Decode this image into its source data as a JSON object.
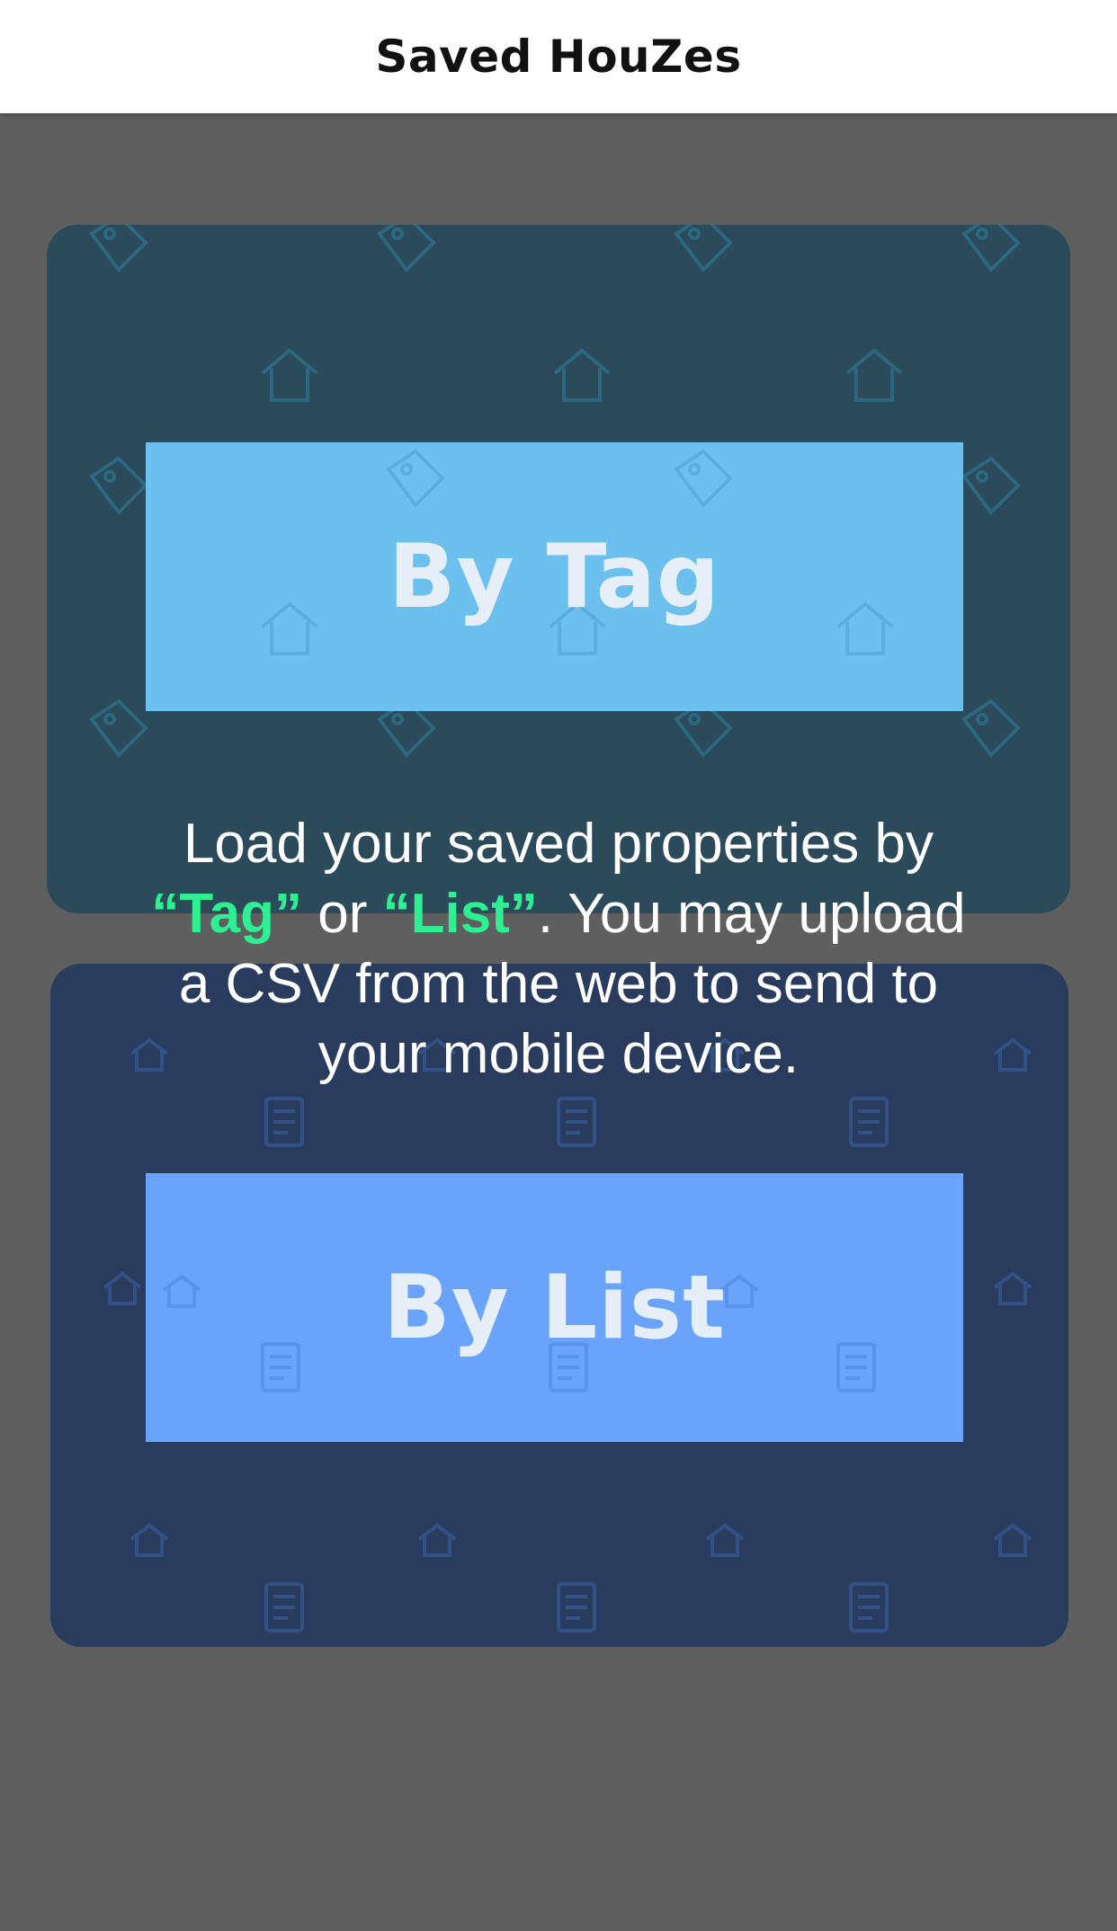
{
  "header": {
    "title": "Saved HouZes"
  },
  "buttons": {
    "by_tag": "By Tag",
    "by_list": "By List"
  },
  "message": {
    "line1": "Load your saved properties by",
    "tag_quote": "“Tag”",
    "or": " or ",
    "list_quote": "“List”",
    "after_list": ". You may upload",
    "line3": "a CSV from the web to send to",
    "line4": "your mobile device."
  },
  "colors": {
    "highlight": "#2ef093",
    "tag_button": "#6bc0ee",
    "list_button": "#6aa3fb",
    "overlay_bg": "#5f5f5f"
  },
  "icons": {
    "tag_card": [
      "house-icon",
      "tag-icon"
    ],
    "list_card": [
      "house-icon",
      "document-icon"
    ]
  }
}
